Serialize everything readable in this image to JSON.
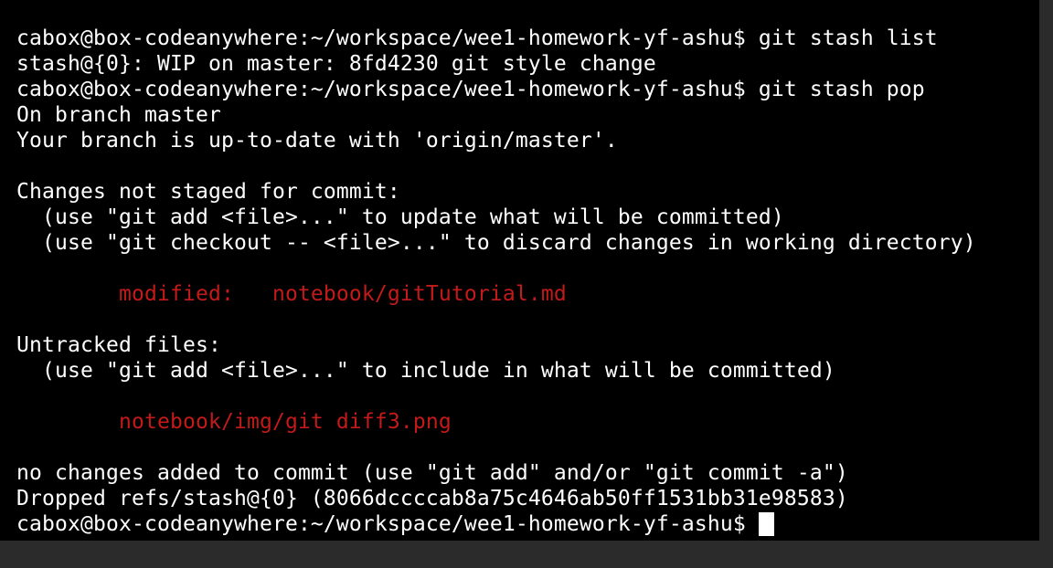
{
  "terminal": {
    "lines": [
      {
        "text": "cabox@box-codeanywhere:~/workspace/wee1-homework-yf-ashu$ git stash list",
        "color": "white"
      },
      {
        "text": "stash@{0}: WIP on master: 8fd4230 git style change",
        "color": "white"
      },
      {
        "text": "cabox@box-codeanywhere:~/workspace/wee1-homework-yf-ashu$ git stash pop",
        "color": "white"
      },
      {
        "text": "On branch master",
        "color": "white"
      },
      {
        "text": "Your branch is up-to-date with 'origin/master'.",
        "color": "white"
      },
      {
        "text": "",
        "color": "white"
      },
      {
        "text": "Changes not staged for commit:",
        "color": "white"
      },
      {
        "text": "  (use \"git add <file>...\" to update what will be committed)",
        "color": "white"
      },
      {
        "text": "  (use \"git checkout -- <file>...\" to discard changes in working directory)",
        "color": "white"
      },
      {
        "text": "",
        "color": "white"
      },
      {
        "text": "        modified:   notebook/gitTutorial.md",
        "color": "red"
      },
      {
        "text": "",
        "color": "white"
      },
      {
        "text": "Untracked files:",
        "color": "white"
      },
      {
        "text": "  (use \"git add <file>...\" to include in what will be committed)",
        "color": "white"
      },
      {
        "text": "",
        "color": "white"
      },
      {
        "text": "        notebook/img/git diff3.png",
        "color": "red"
      },
      {
        "text": "",
        "color": "white"
      },
      {
        "text": "no changes added to commit (use \"git add\" and/or \"git commit -a\")",
        "color": "white"
      },
      {
        "text": "Dropped refs/stash@{0} (8066dccccab8a75c4646ab50ff1531bb31e98583)",
        "color": "white"
      }
    ],
    "prompt": "cabox@box-codeanywhere:~/workspace/wee1-homework-yf-ashu$ ",
    "colors": {
      "background": "#000000",
      "foreground": "#ffffff",
      "red": "#c31a1a",
      "frame": "#2b2b2b"
    }
  }
}
